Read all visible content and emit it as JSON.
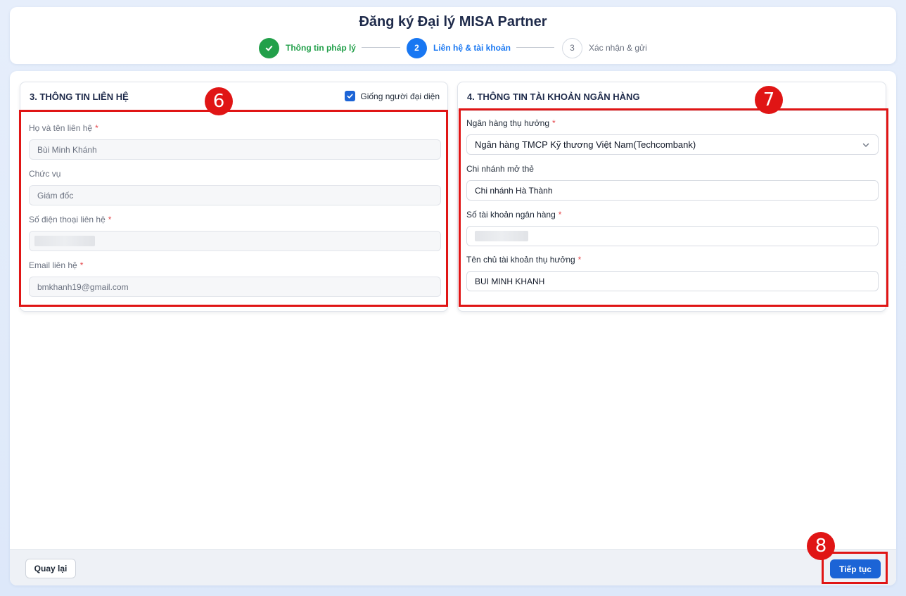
{
  "page_title": "Đăng ký Đại lý MISA Partner",
  "stepper": {
    "steps": [
      {
        "label": "Thông tin pháp lý",
        "number": "",
        "state": "done"
      },
      {
        "label": "Liên hệ & tài khoản",
        "number": "2",
        "state": "active"
      },
      {
        "label": "Xác nhận & gửi",
        "number": "3",
        "state": "todo"
      }
    ]
  },
  "contact": {
    "title": "3. THÔNG TIN LIÊN HỆ",
    "same_as_rep_label": "Giống người đại diện",
    "same_as_rep_checked": true,
    "fullname_label": "Họ và tên liên hệ",
    "fullname_value": "Bùi Minh Khánh",
    "position_label": "Chức vụ",
    "position_value": "Giám đốc",
    "phone_label": "Số điện thoại liên hệ",
    "phone_value": "",
    "email_label": "Email liên hệ",
    "email_value": "bmkhanh19@gmail.com"
  },
  "bank": {
    "title": "4. THÔNG TIN TÀI KHOẢN NGÂN HÀNG",
    "bank_label": "Ngân hàng thụ hưởng",
    "bank_value": "Ngân hàng TMCP Kỹ thương Việt Nam(Techcombank)",
    "branch_label": "Chi nhánh mở thẻ",
    "branch_value": "Chi nhánh Hà Thành",
    "account_label": "Số tài khoản ngân hàng",
    "account_value": "",
    "holder_label": "Tên chủ tài khoản thụ hưởng",
    "holder_value": "BUI MINH KHANH"
  },
  "required_mark": "*",
  "annotations": {
    "contact": "6",
    "bank": "7",
    "next": "8"
  },
  "footer": {
    "back_label": "Quay lại",
    "next_label": "Tiếp tục"
  },
  "colors": {
    "primary": "#1c64d6",
    "success": "#22a04a",
    "annotation": "#e01515",
    "required": "#e5484d"
  }
}
